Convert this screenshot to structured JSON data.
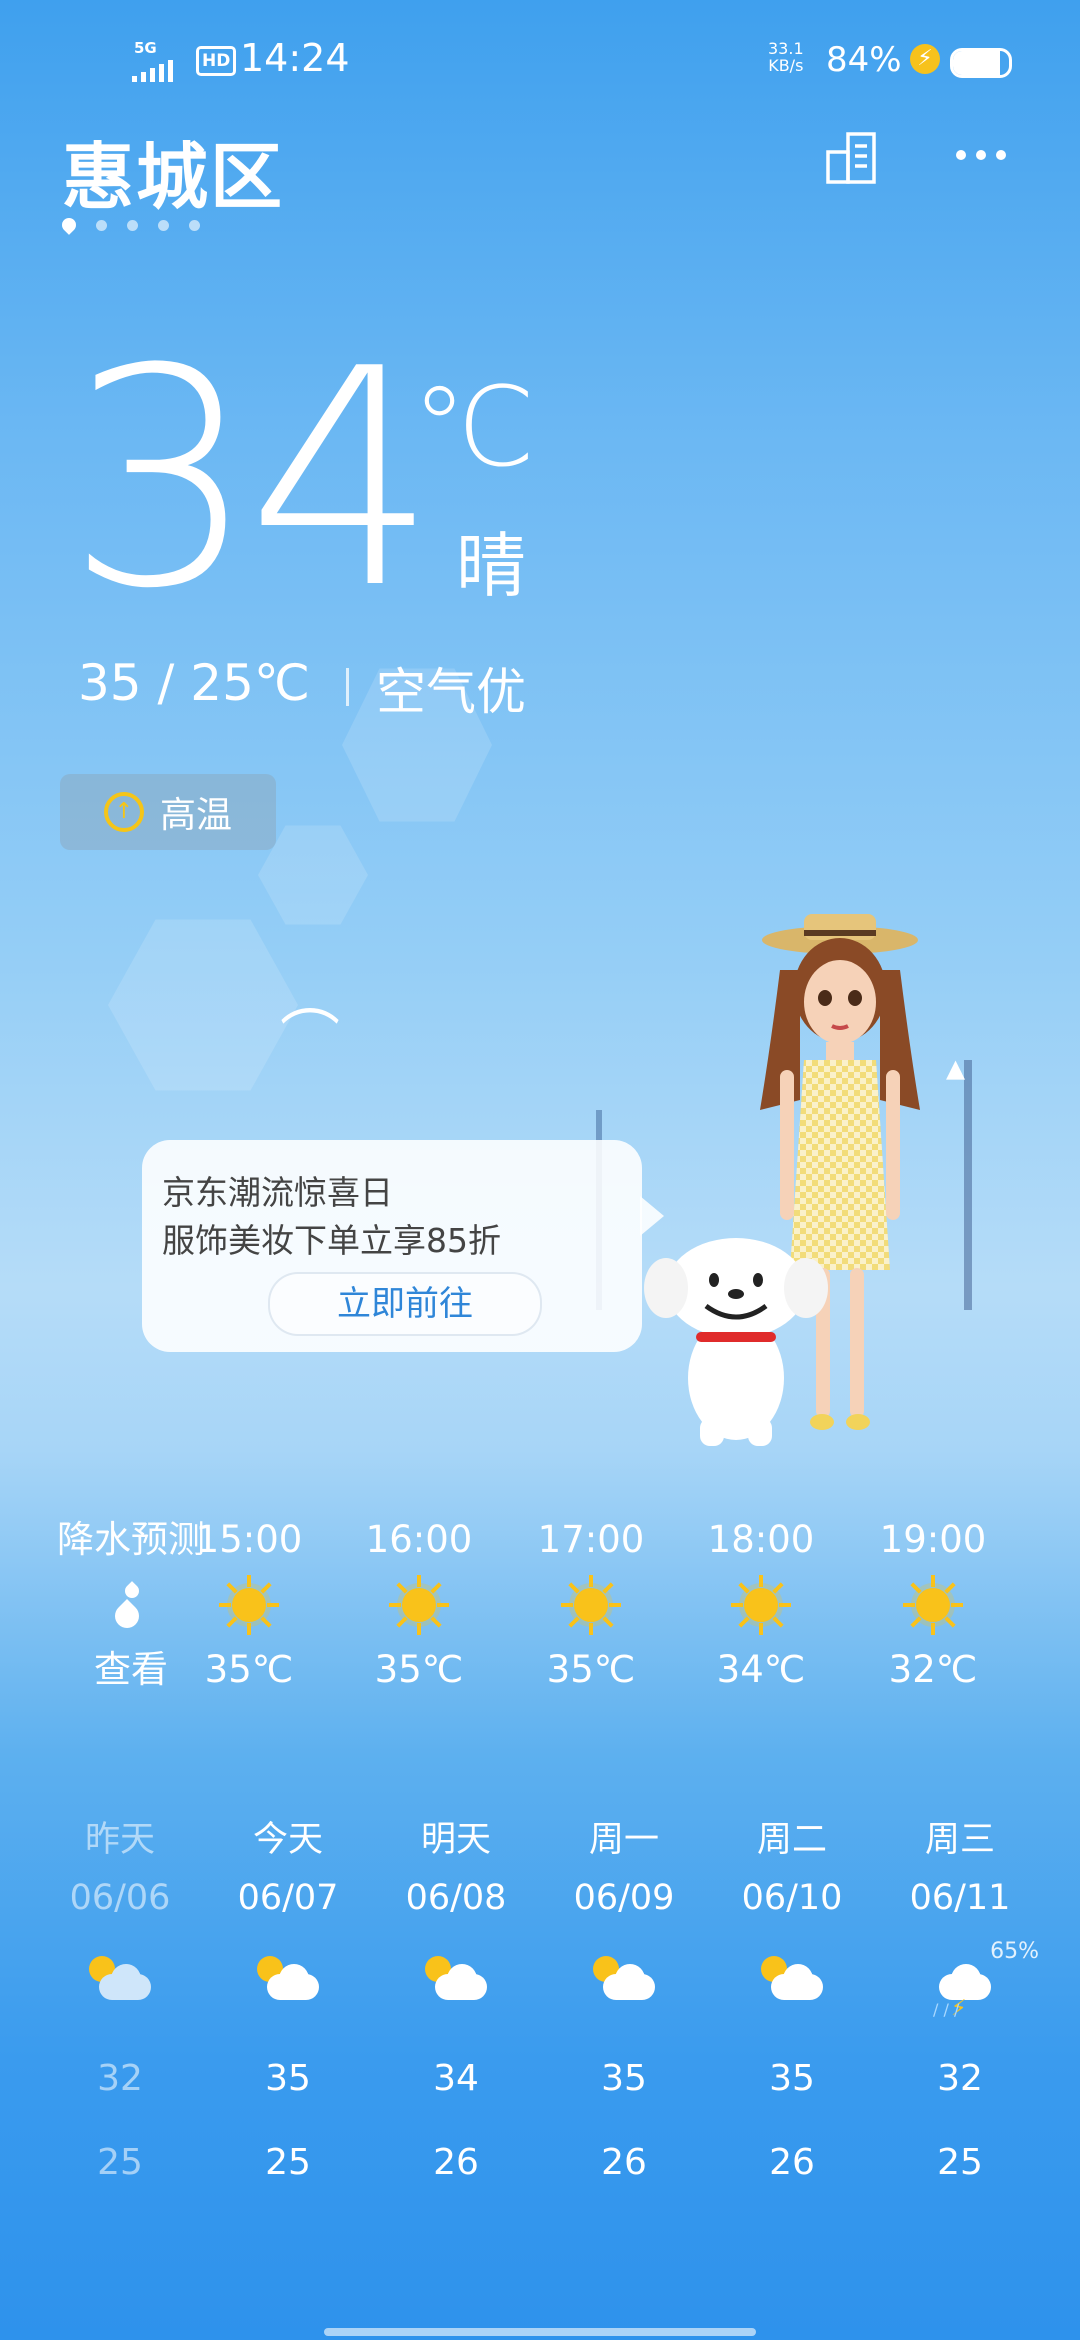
{
  "status_bar": {
    "network": "5G",
    "hd": "HD",
    "time": "14:24",
    "speed_value": "33.1",
    "speed_unit": "KB/s",
    "battery_pct": "84%",
    "battery_level": 0.84
  },
  "header": {
    "city": "惠城区",
    "pages": 5,
    "active_page": 0
  },
  "current": {
    "temp": "34",
    "unit": "℃",
    "condition": "晴",
    "range": "35  /  25℃",
    "air_quality": "空气优",
    "alert": "高温"
  },
  "ad": {
    "line1": "京东潮流惊喜日",
    "line2": "服饰美妆下单立享85折",
    "button": "立即前往"
  },
  "hourly": {
    "precip_title": "降水预测",
    "precip_action": "查看",
    "items": [
      {
        "time": "15:00",
        "temp": "35℃",
        "icon": "sun-icon"
      },
      {
        "time": "16:00",
        "temp": "35℃",
        "icon": "sun-icon"
      },
      {
        "time": "17:00",
        "temp": "35℃",
        "icon": "sun-icon"
      },
      {
        "time": "18:00",
        "temp": "34℃",
        "icon": "sun-icon"
      },
      {
        "time": "19:00",
        "temp": "32℃",
        "icon": "sun-icon"
      }
    ]
  },
  "daily": [
    {
      "day": "昨天",
      "date": "06/06",
      "hi": "32",
      "lo": "25",
      "icon": "partly-cloudy-icon",
      "past": true
    },
    {
      "day": "今天",
      "date": "06/07",
      "hi": "35",
      "lo": "25",
      "icon": "partly-cloudy-icon"
    },
    {
      "day": "明天",
      "date": "06/08",
      "hi": "34",
      "lo": "26",
      "icon": "partly-cloudy-icon"
    },
    {
      "day": "周一",
      "date": "06/09",
      "hi": "35",
      "lo": "26",
      "icon": "partly-cloudy-icon"
    },
    {
      "day": "周二",
      "date": "06/10",
      "hi": "35",
      "lo": "26",
      "icon": "partly-cloudy-icon"
    },
    {
      "day": "周三",
      "date": "06/11",
      "hi": "32",
      "lo": "25",
      "icon": "thunderstorm-icon",
      "precip": "65%"
    }
  ],
  "colors": {
    "accent_yellow": "#f9c21a",
    "link_blue": "#2f86d8"
  }
}
